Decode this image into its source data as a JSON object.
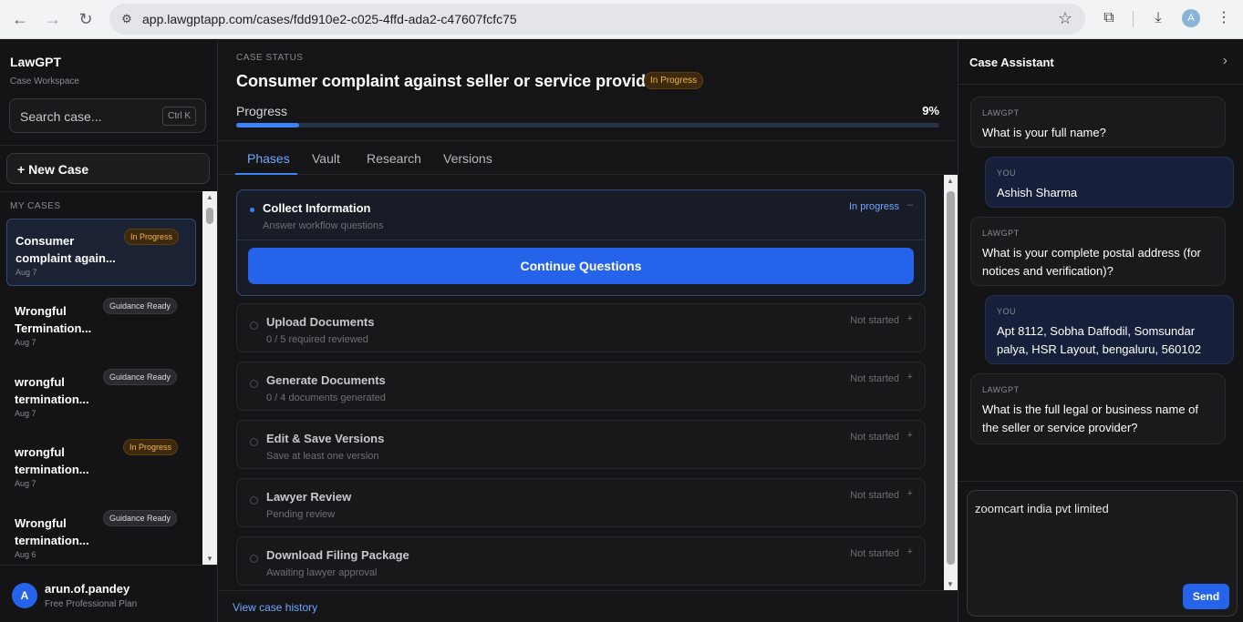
{
  "browser": {
    "url": "app.lawgptapp.com/cases/fdd910e2-c025-4ffd-ada2-c47607fcfc75",
    "profile_initial": "A"
  },
  "sidebar": {
    "brand": "LawGPT",
    "subtitle": "Case Workspace",
    "search_placeholder": "Search case...",
    "search_shortcut": "Ctrl K",
    "new_case_label": "+ New Case",
    "section_label": "MY CASES",
    "cases": [
      {
        "title": "Consumer complaint again...",
        "status": "In Progress",
        "date": "Aug 7"
      },
      {
        "title": "Wrongful Termination...",
        "status": "Guidance Ready",
        "date": "Aug 7"
      },
      {
        "title": "wrongful termination...",
        "status": "Guidance Ready",
        "date": "Aug 7"
      },
      {
        "title": "wrongful termination...",
        "status": "In Progress",
        "date": "Aug 7"
      },
      {
        "title": "Wrongful termination...",
        "status": "Guidance Ready",
        "date": "Aug 6"
      }
    ],
    "user": {
      "initial": "A",
      "name": "arun.of.pandey",
      "plan": "Free Professional Plan"
    }
  },
  "main": {
    "status_label": "CASE STATUS",
    "title": "Consumer complaint against seller or service provider",
    "status_badge": "In Progress",
    "progress_label": "Progress",
    "progress_value": 9,
    "progress_text": "9%",
    "tabs": [
      "Phases",
      "Vault",
      "Research",
      "Versions"
    ],
    "phases": [
      {
        "title": "Collect Information",
        "subtitle": "Answer workflow questions",
        "status": "In progress",
        "toggle": "–",
        "action": "Continue Questions"
      },
      {
        "title": "Upload Documents",
        "subtitle": "0 / 5 required reviewed",
        "status": "Not started",
        "toggle": "+"
      },
      {
        "title": "Generate Documents",
        "subtitle": "0 / 4 documents generated",
        "status": "Not started",
        "toggle": "+"
      },
      {
        "title": "Edit & Save Versions",
        "subtitle": "Save at least one version",
        "status": "Not started",
        "toggle": "+"
      },
      {
        "title": "Lawyer Review",
        "subtitle": "Pending review",
        "status": "Not started",
        "toggle": "+"
      },
      {
        "title": "Download Filing Package",
        "subtitle": "Awaiting lawyer approval",
        "status": "Not started",
        "toggle": "+"
      }
    ],
    "history_link": "View case history"
  },
  "assistant": {
    "title": "Case Assistant",
    "messages": [
      {
        "who": "LAWGPT",
        "text": "What is your full name?"
      },
      {
        "who": "YOU",
        "text": "Ashish Sharma"
      },
      {
        "who": "LAWGPT",
        "text": "What is your complete postal address (for notices and verification)?"
      },
      {
        "who": "YOU",
        "text": "Apt 8112, Sobha Daffodil, Somsundar palya, HSR Layout, bengaluru, 560102"
      },
      {
        "who": "LAWGPT",
        "text": "What is the full legal or business name of the seller or service provider?"
      }
    ],
    "input_value": "zoomcart india pvt limited",
    "send_label": "Send"
  },
  "colors": {
    "accent": "#2563eb",
    "link": "#6ea8ff",
    "in_progress": "#f3b44d"
  }
}
